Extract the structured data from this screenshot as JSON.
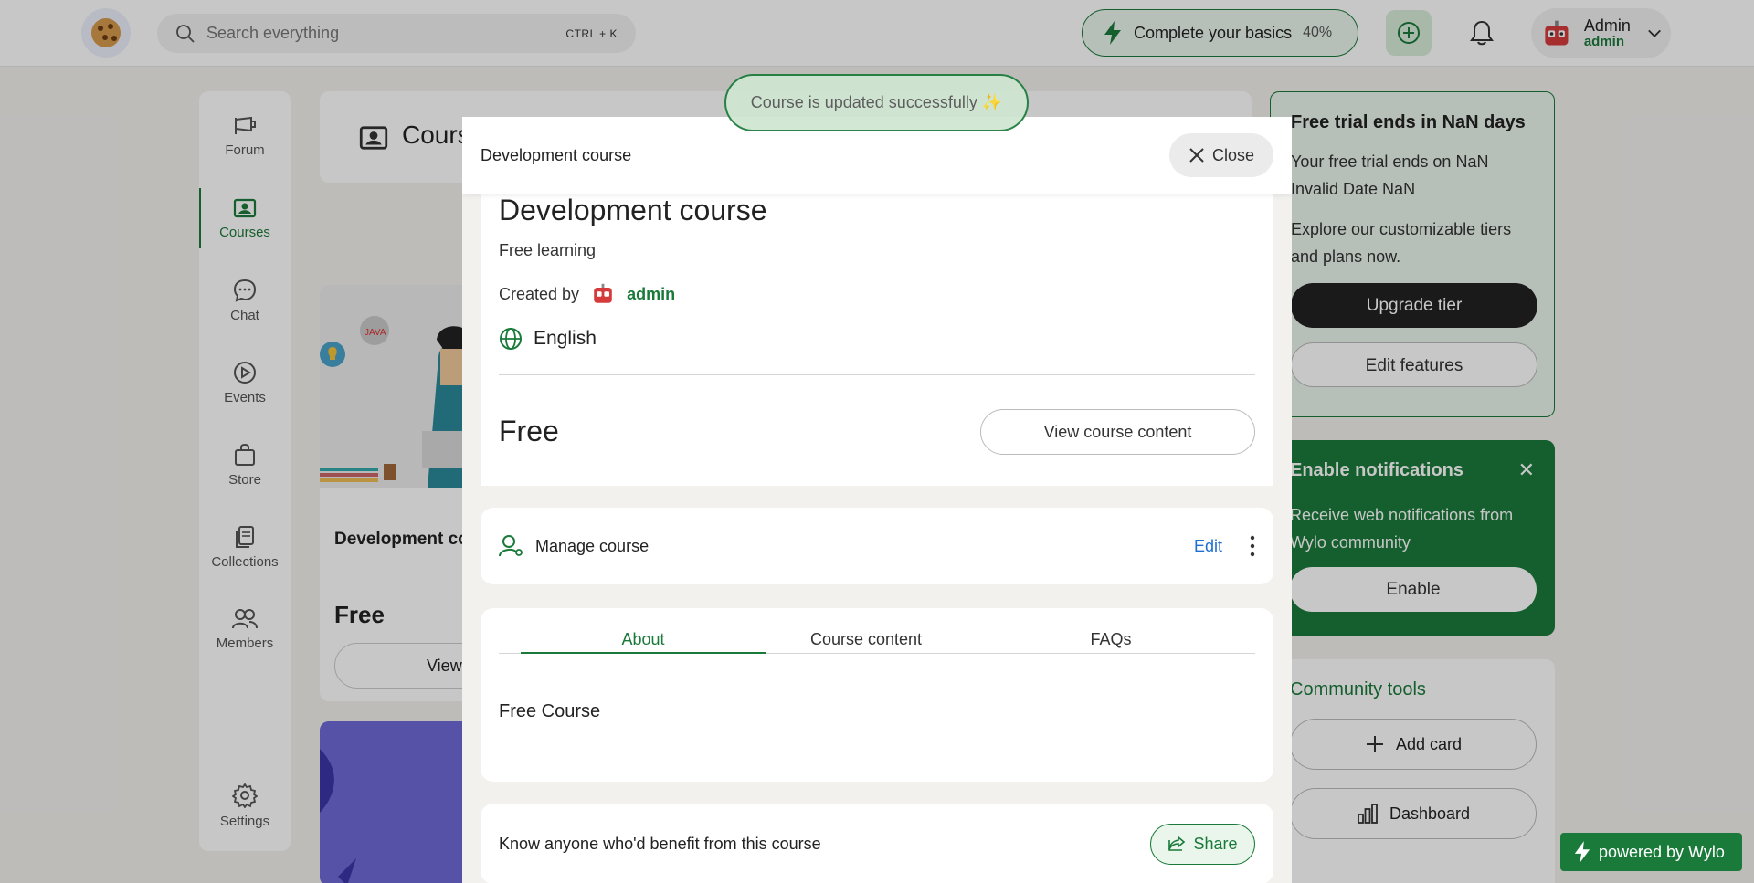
{
  "topbar": {
    "search_placeholder": "Search everything",
    "search_shortcut": "CTRL + K",
    "basics_label": "Complete your basics",
    "basics_percent": "40%",
    "user_name": "Admin",
    "user_role": "admin"
  },
  "sidebar": {
    "items": [
      {
        "label": "Forum",
        "icon": "megaphone-icon"
      },
      {
        "label": "Courses",
        "icon": "courses-icon",
        "active": true
      },
      {
        "label": "Chat",
        "icon": "chat-bubble-icon"
      },
      {
        "label": "Events",
        "icon": "play-circle-icon"
      },
      {
        "label": "Store",
        "icon": "shopping-bag-icon"
      },
      {
        "label": "Collections",
        "icon": "collections-icon"
      },
      {
        "label": "Members",
        "icon": "members-icon"
      }
    ],
    "settings_label": "Settings"
  },
  "main": {
    "header_title": "Cours",
    "card1_title": "Development co",
    "card1_price": "Free",
    "card1_button": "View"
  },
  "right": {
    "trial_title": "Free trial ends in NaN days",
    "trial_text1": "Your free trial ends on NaN Invalid Date NaN",
    "trial_text2": "Explore our customizable tiers and plans now.",
    "upgrade_label": "Upgrade tier",
    "edit_features_label": "Edit features",
    "notif_title": "Enable notifications",
    "notif_text": "Receive web notifications from Wylo community",
    "enable_label": "Enable",
    "tools_title": "Community tools",
    "add_card_label": "Add card",
    "dashboard_label": "Dashboard",
    "powered_label": "powered by Wylo"
  },
  "toast": "Course is updated successfully ✨",
  "modal": {
    "header_title": "Development course",
    "close_label": "Close",
    "course_title": "Development course",
    "subtitle": "Free learning",
    "created_by_label": "Created by",
    "creator": "admin",
    "language": "English",
    "price": "Free",
    "view_content_label": "View course content",
    "manage_label": "Manage course",
    "edit_label": "Edit",
    "tabs": [
      "About",
      "Course content",
      "FAQs"
    ],
    "about_text": "Free Course",
    "share_prompt": "Know anyone who'd benefit from this course",
    "share_label": "Share"
  },
  "colors": {
    "brand_green": "#1a7a3a",
    "link_blue": "#1f6fd0"
  }
}
